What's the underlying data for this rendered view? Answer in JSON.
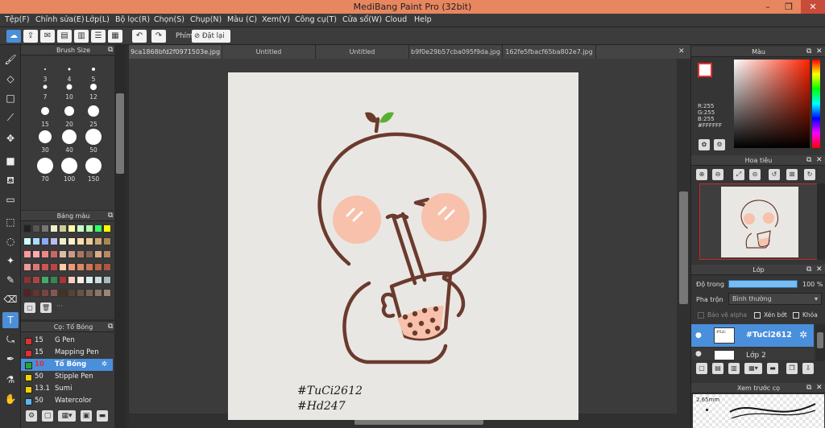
{
  "app": {
    "title": "MediBang Paint Pro (32bit)"
  },
  "window_controls": {
    "minimize": "–",
    "restore": "❐",
    "close": "✕"
  },
  "menu": [
    "Tệp(F)",
    "Chỉnh sửa(E)",
    "Lớp(L)",
    "Bộ lọc(R)",
    "Chọn(S)",
    "Chụp(N)",
    "Màu (C)",
    "Xem(V)",
    "Công cụ(T)",
    "Cửa sổ(W)",
    "Cloud",
    "Help"
  ],
  "toolbar": {
    "keys_label": "Phím",
    "reset_label": "Đặt lại"
  },
  "panels": {
    "brush_size": "Brush Size",
    "palette": "Bảng màu",
    "brush_panel": "Cọ: Tố Bóng",
    "color": "Màu",
    "navigator": "Hoa tiêu",
    "layers": "Lớp",
    "brush_preview": "Xem trước cọ"
  },
  "brush_sizes": [
    "3",
    "4",
    "5",
    "7",
    "10",
    "12",
    "15",
    "20",
    "25",
    "30",
    "40",
    "50",
    "70",
    "100",
    "150"
  ],
  "palette_colors": [
    "#222222",
    "#555555",
    "#777777",
    "#eeeecc",
    "#cccc99",
    "#ffffaa",
    "#ccffcc",
    "#aaffaa",
    "#33ff66",
    "#ffff00",
    "#ccffff",
    "#aaddff",
    "#88aaff",
    "#bbbbee",
    "#eeeecc",
    "#ffeecc",
    "#ffddaa",
    "#eecc99",
    "#ccaa77",
    "#aa8855",
    "#ff9999",
    "#ffaaaa",
    "#ee8888",
    "#cc6666",
    "#ddbbaa",
    "#cc9988",
    "#aa7766",
    "#886655",
    "#ddaa88",
    "#bb8866",
    "#ee9999",
    "#dd7777",
    "#cc5555",
    "#bb4444",
    "#ffccaa",
    "#ee9977",
    "#dd8866",
    "#cc7755",
    "#bb6644",
    "#aa5544",
    "#883333",
    "#aa4444",
    "#44aa66",
    "#338855",
    "#aa3333",
    "#ffccbb",
    "#ffeedd",
    "#ddeeee",
    "#ccdddd",
    "#aabbbb",
    "#552222",
    "#663333",
    "#774444",
    "#885555",
    "#443322",
    "#554433",
    "#665544",
    "#776655",
    "#887766",
    "#998877"
  ],
  "brushes": [
    {
      "size": "15",
      "name": "G Pen",
      "color": "#e0302f"
    },
    {
      "size": "15",
      "name": "Mapping Pen",
      "color": "#e0302f"
    },
    {
      "size": "10",
      "name": "Tố Bóng",
      "color": "#21a83a"
    },
    {
      "size": "50",
      "name": "Stipple Pen",
      "color": "#f5d000"
    },
    {
      "size": "13.1",
      "name": "Sumi",
      "color": "#f5d000"
    },
    {
      "size": "50",
      "name": "Watercolor",
      "color": "#5ab6f0"
    }
  ],
  "tabs": [
    "9ca1868bfd2f0971503e.jpg",
    "Untitled",
    "Untitled",
    "b9f0e29b57cba095f9da.jpg",
    "162fe5fbacf65ba802e7.jpg"
  ],
  "color_panel": {
    "r": "R:255",
    "g": "G:255",
    "b": "B:255",
    "hex": "#FFFFFF"
  },
  "layer_panel": {
    "opacity_label": "Độ trong",
    "opacity_value": 100,
    "opacity_text": "100 %",
    "blend_label": "Pha trộn",
    "blend_value": "Bình thường",
    "alpha_label": "Bảo vệ alpha",
    "clip_label": "Xén bớt",
    "lock_label": "Khóa",
    "layer1_name": "#TuCi2612",
    "layer2_name": "Lớp 2"
  },
  "brush_preview": {
    "size_text": "2.65mm"
  },
  "canvas_text": {
    "line1": "#TuCi2612",
    "line2": "#Hd247"
  },
  "colors": {
    "accent": "#4c8fd8",
    "titlebar": "#e8865f",
    "stroke": "#6b3a2e",
    "cheek": "#f7c1ab"
  }
}
